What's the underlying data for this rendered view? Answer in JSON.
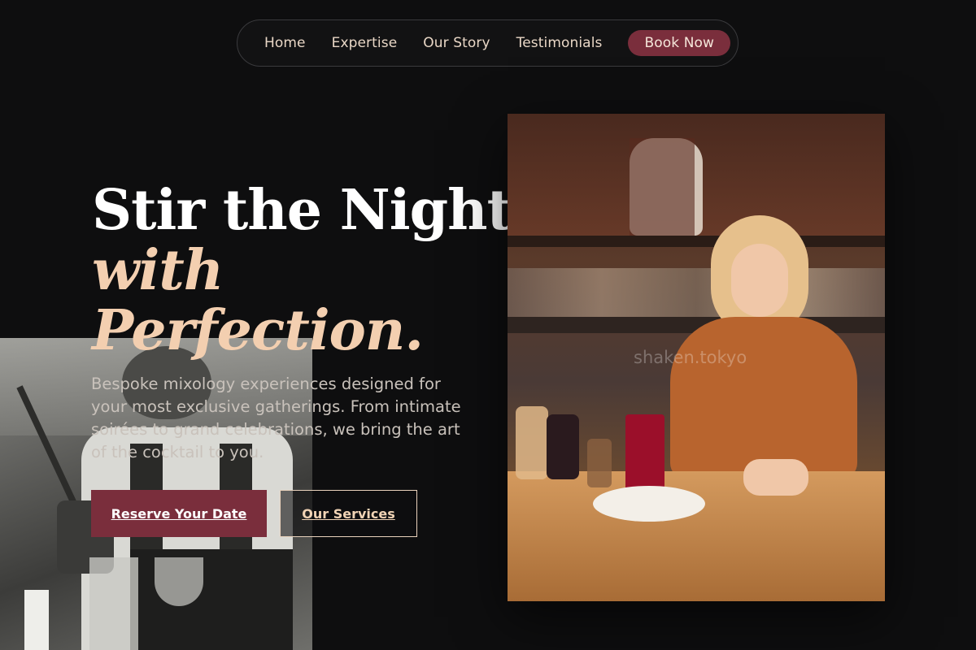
{
  "nav": {
    "items": [
      "Home",
      "Expertise",
      "Our Story",
      "Testimonials"
    ],
    "cta": "Book Now"
  },
  "hero": {
    "title_line1": "Stir the Night",
    "title_line2": "with",
    "title_line3": "Perfection.",
    "description": "Bespoke mixology experiences designed for your most exclusive gatherings. From intimate soirées to grand celebrations, we bring the art of the cocktail to you.",
    "primary_button": "Reserve Your Date",
    "secondary_button": "Our Services"
  },
  "photo": {
    "watermark": "shaken.tokyo"
  },
  "colors": {
    "background": "#0e0e0f",
    "accent": "#7a2e3c",
    "peach": "#f3cfb0"
  }
}
